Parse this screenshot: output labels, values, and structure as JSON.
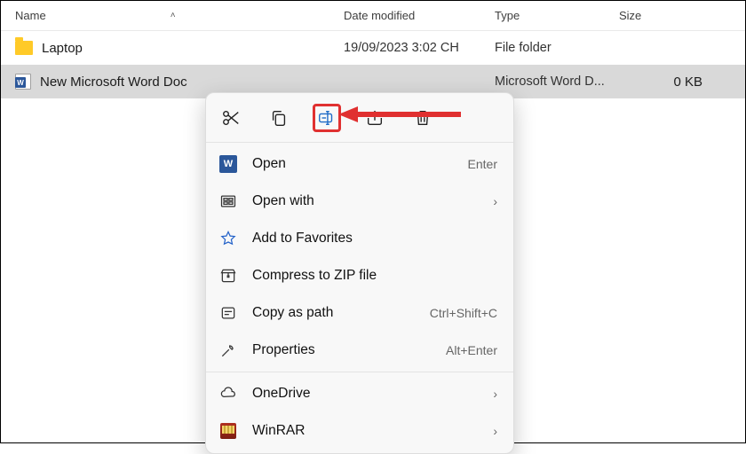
{
  "columns": {
    "name": "Name",
    "date": "Date modified",
    "type": "Type",
    "size": "Size"
  },
  "rows": [
    {
      "name": "Laptop",
      "date": "19/09/2023 3:02 CH",
      "type": "File folder",
      "size": ""
    },
    {
      "name": "New Microsoft Word Doc",
      "date": "",
      "type": "Microsoft Word D...",
      "size": "0 KB"
    }
  ],
  "menu": {
    "open": {
      "label": "Open",
      "shortcut": "Enter"
    },
    "openwith": {
      "label": "Open with"
    },
    "favorites": {
      "label": "Add to Favorites"
    },
    "zip": {
      "label": "Compress to ZIP file"
    },
    "copypath": {
      "label": "Copy as path",
      "shortcut": "Ctrl+Shift+C"
    },
    "properties": {
      "label": "Properties",
      "shortcut": "Alt+Enter"
    },
    "onedrive": {
      "label": "OneDrive"
    },
    "winrar": {
      "label": "WinRAR"
    }
  }
}
